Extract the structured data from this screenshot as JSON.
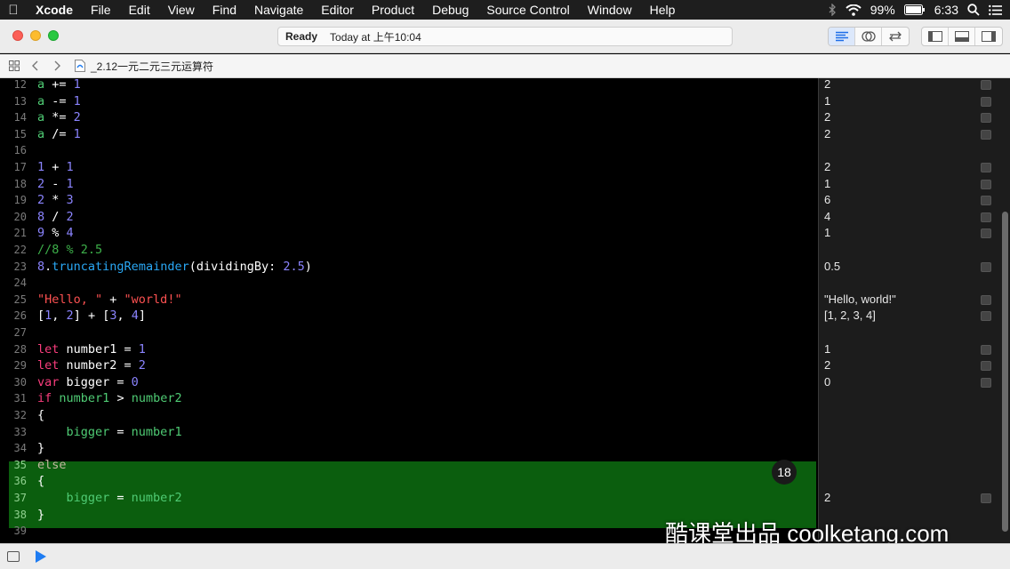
{
  "menubar": {
    "items": [
      "Xcode",
      "File",
      "Edit",
      "View",
      "Find",
      "Navigate",
      "Editor",
      "Product",
      "Debug",
      "Source Control",
      "Window",
      "Help"
    ],
    "battery": "99%",
    "time": "6:33"
  },
  "toolbar": {
    "status": "Ready",
    "timestamp": "Today at 上午10:04"
  },
  "jumpbar": {
    "file": "_2.12一元二元三元运算符"
  },
  "editor": {
    "lines": [
      {
        "n": "12",
        "t": [
          [
            "a",
            "var"
          ],
          [
            " += ",
            "plain"
          ],
          [
            "1",
            "num"
          ]
        ]
      },
      {
        "n": "13",
        "t": [
          [
            "a",
            "var"
          ],
          [
            " -= ",
            "plain"
          ],
          [
            "1",
            "num"
          ]
        ]
      },
      {
        "n": "14",
        "t": [
          [
            "a",
            "var"
          ],
          [
            " *= ",
            "plain"
          ],
          [
            "2",
            "num"
          ]
        ]
      },
      {
        "n": "15",
        "t": [
          [
            "a",
            "var"
          ],
          [
            " /= ",
            "plain"
          ],
          [
            "1",
            "num"
          ]
        ]
      },
      {
        "n": "16",
        "t": []
      },
      {
        "n": "17",
        "t": [
          [
            "1",
            "num"
          ],
          [
            " + ",
            "plain"
          ],
          [
            "1",
            "num"
          ]
        ]
      },
      {
        "n": "18",
        "t": [
          [
            "2",
            "num"
          ],
          [
            " - ",
            "plain"
          ],
          [
            "1",
            "num"
          ]
        ]
      },
      {
        "n": "19",
        "t": [
          [
            "2",
            "num"
          ],
          [
            " * ",
            "plain"
          ],
          [
            "3",
            "num"
          ]
        ]
      },
      {
        "n": "20",
        "t": [
          [
            "8",
            "num"
          ],
          [
            " / ",
            "plain"
          ],
          [
            "2",
            "num"
          ]
        ]
      },
      {
        "n": "21",
        "t": [
          [
            "9",
            "num"
          ],
          [
            " % ",
            "plain"
          ],
          [
            "4",
            "num"
          ]
        ]
      },
      {
        "n": "22",
        "t": [
          [
            "//8 % 2.5",
            "com"
          ]
        ]
      },
      {
        "n": "23",
        "t": [
          [
            "8",
            "num"
          ],
          [
            ".",
            "plain"
          ],
          [
            "truncatingRemainder",
            "meth"
          ],
          [
            "(dividingBy: ",
            "plain"
          ],
          [
            "2.5",
            "num"
          ],
          [
            ")",
            "plain"
          ]
        ]
      },
      {
        "n": "24",
        "t": []
      },
      {
        "n": "25",
        "t": [
          [
            "\"Hello, \"",
            "str"
          ],
          [
            " + ",
            "plain"
          ],
          [
            "\"world!\"",
            "str"
          ]
        ]
      },
      {
        "n": "26",
        "t": [
          [
            "[",
            "plain"
          ],
          [
            "1",
            "num"
          ],
          [
            ", ",
            "plain"
          ],
          [
            "2",
            "num"
          ],
          [
            "] + [",
            "plain"
          ],
          [
            "3",
            "num"
          ],
          [
            ", ",
            "plain"
          ],
          [
            "4",
            "num"
          ],
          [
            "]",
            "plain"
          ]
        ]
      },
      {
        "n": "27",
        "t": []
      },
      {
        "n": "28",
        "t": [
          [
            "let",
            "key"
          ],
          [
            " number1 = ",
            "plain"
          ],
          [
            "1",
            "num"
          ]
        ]
      },
      {
        "n": "29",
        "t": [
          [
            "let",
            "key"
          ],
          [
            " number2 = ",
            "plain"
          ],
          [
            "2",
            "num"
          ]
        ]
      },
      {
        "n": "30",
        "t": [
          [
            "var",
            "key"
          ],
          [
            " bigger = ",
            "plain"
          ],
          [
            "0",
            "num"
          ]
        ]
      },
      {
        "n": "31",
        "t": [
          [
            "if",
            "key"
          ],
          [
            " ",
            "plain"
          ],
          [
            "number1",
            "var"
          ],
          [
            " > ",
            "plain"
          ],
          [
            "number2",
            "var"
          ]
        ]
      },
      {
        "n": "32",
        "t": [
          [
            "{",
            "plain"
          ]
        ]
      },
      {
        "n": "33",
        "t": [
          [
            "    bigger",
            "var"
          ],
          [
            " = ",
            "plain"
          ],
          [
            "number1",
            "var"
          ]
        ]
      },
      {
        "n": "34",
        "t": [
          [
            "}",
            "plain"
          ]
        ]
      },
      {
        "n": "35",
        "t": [
          [
            "else",
            "kw2"
          ]
        ]
      },
      {
        "n": "36",
        "t": [
          [
            "{",
            "plain"
          ]
        ]
      },
      {
        "n": "37",
        "t": [
          [
            "    bigger",
            "var"
          ],
          [
            " = ",
            "plain"
          ],
          [
            "number2",
            "var"
          ]
        ]
      },
      {
        "n": "38",
        "t": [
          [
            "}",
            "plain"
          ]
        ]
      },
      {
        "n": "39",
        "t": []
      }
    ],
    "highlight_badge": "18"
  },
  "results": [
    {
      "row": 0,
      "v": "2"
    },
    {
      "row": 1,
      "v": "1"
    },
    {
      "row": 2,
      "v": "2"
    },
    {
      "row": 3,
      "v": "2"
    },
    {
      "row": 5,
      "v": "2"
    },
    {
      "row": 6,
      "v": "1"
    },
    {
      "row": 7,
      "v": "6"
    },
    {
      "row": 8,
      "v": "4"
    },
    {
      "row": 9,
      "v": "1"
    },
    {
      "row": 11,
      "v": "0.5"
    },
    {
      "row": 13,
      "v": "\"Hello, world!\""
    },
    {
      "row": 14,
      "v": "[1, 2, 3, 4]"
    },
    {
      "row": 16,
      "v": "1"
    },
    {
      "row": 17,
      "v": "2"
    },
    {
      "row": 18,
      "v": "0"
    },
    {
      "row": 25,
      "v": "2"
    }
  ],
  "watermark": "酷课堂出品 coolketang.com",
  "colors": {
    "variable": "#4fcb74",
    "number": "#8b84ff",
    "keyword": "#fa3d7d",
    "string": "#fc5151",
    "comment": "#3db04a",
    "method": "#2aa8f5",
    "highlight": "#0b5e0e"
  }
}
